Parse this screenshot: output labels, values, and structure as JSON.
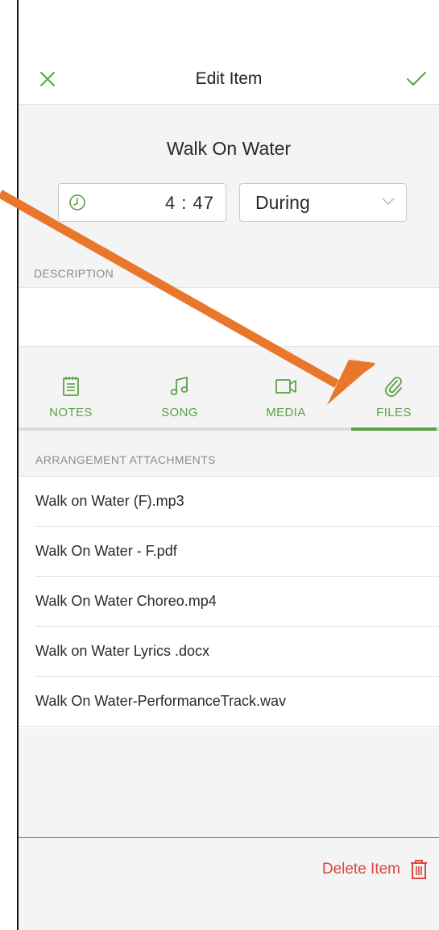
{
  "nav": {
    "title": "Edit Item",
    "close_icon": "close-icon",
    "confirm_icon": "checkmark-icon"
  },
  "item": {
    "title": "Walk On Water",
    "duration": "4 : 47",
    "timing": "During",
    "description_label": "DESCRIPTION"
  },
  "tabs": [
    {
      "label": "NOTES",
      "icon": "notes-icon"
    },
    {
      "label": "SONG",
      "icon": "music-note-icon"
    },
    {
      "label": "MEDIA",
      "icon": "video-icon"
    },
    {
      "label": "FILES",
      "icon": "paperclip-icon",
      "active": true
    }
  ],
  "attachments": {
    "section_label": "ARRANGEMENT ATTACHMENTS",
    "files": [
      "Walk on Water (F).mp3",
      "Walk On Water - F.pdf",
      "Walk On Water Choreo.mp4",
      "Walk on Water Lyrics .docx",
      "Walk On Water-PerformanceTrack.wav"
    ]
  },
  "footer": {
    "delete_label": "Delete Item",
    "delete_icon": "trash-icon"
  },
  "colors": {
    "accent_green": "#5aa145",
    "danger_red": "#d9473f",
    "annotation_orange": "#e8772b"
  }
}
